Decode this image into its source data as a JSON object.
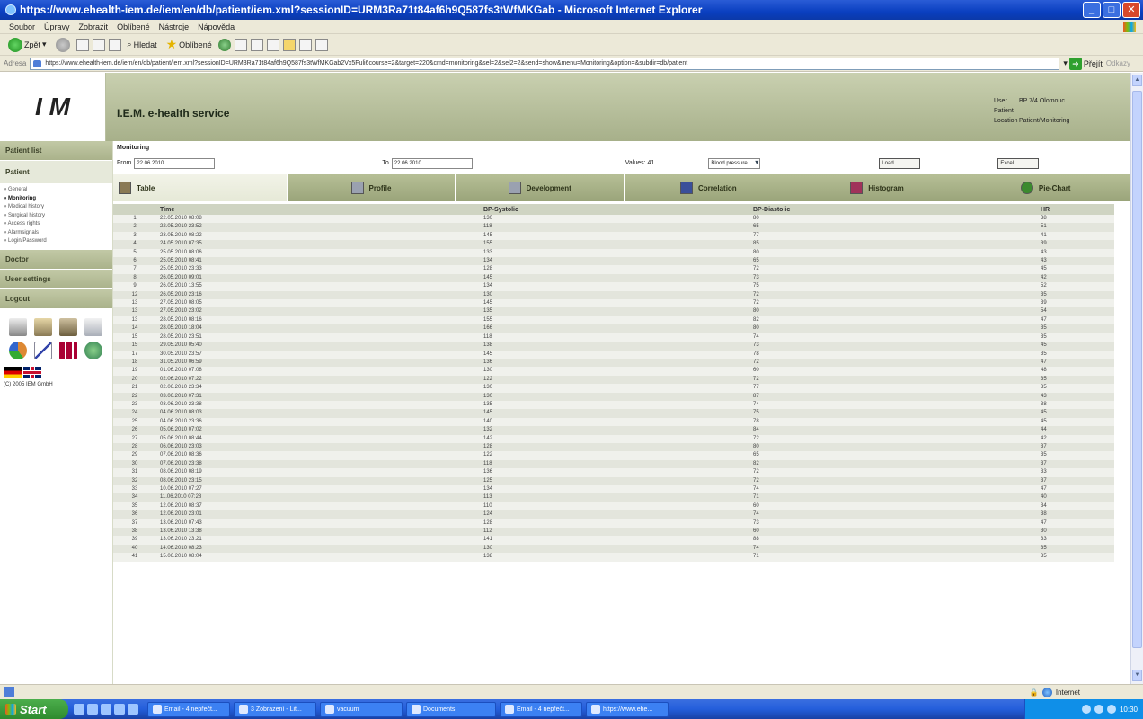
{
  "window": {
    "title": "https://www.ehealth-iem.de/iem/en/db/patient/iem.xml?sessionID=URM3Ra71t84af6h9Q587fs3tWfMKGab - Microsoft Internet Explorer",
    "minimize": "_",
    "maximize": "□",
    "close": "✕"
  },
  "menubar": [
    "Soubor",
    "Úpravy",
    "Zobrazit",
    "Oblíbené",
    "Nástroje",
    "Nápověda"
  ],
  "toolbar": {
    "back_label": "Zpět",
    "search_label": "Hledat",
    "favorites_label": "Oblíbené"
  },
  "addressbar": {
    "label": "Adresa",
    "url": "https://www.ehealth-iem.de/iem/en/db/patient/iem.xml?sessionID=URM3Ra71t84af6h9Q587fs3tWfMKGab2Vx5Fuli6course=2&target=220&cmd=monitoring&sel=2&sel2=2&send=show&menu=Monitoring&option=&subdir=db/patient",
    "go_label": "Přejít",
    "links_label": "Odkazy"
  },
  "app": {
    "logo_text": "I M",
    "service_title": "I.E.M. e-health service",
    "user": {
      "user_key": "User",
      "user_value": "BP 7/4 Olomouc",
      "patient_key": "Patient",
      "patient_value": "",
      "location_key": "Location",
      "location_value": "Patient/Monitoring"
    }
  },
  "sidebar": {
    "patient_list": "Patient list",
    "patient": "Patient",
    "sub_items": [
      {
        "label": "» General",
        "active": false
      },
      {
        "label": "» Monitoring",
        "active": true
      },
      {
        "label": "» Medical history",
        "active": false
      },
      {
        "label": "» Surgical history",
        "active": false
      },
      {
        "label": "» Access rights",
        "active": false
      },
      {
        "label": "» Alarmsignals",
        "active": false
      },
      {
        "label": "» Login/Password",
        "active": false
      }
    ],
    "doctor": "Doctor",
    "user_settings": "User settings",
    "logout": "Logout",
    "copyright": "(C) 2005 IEM GmbH"
  },
  "content": {
    "section_title": "Monitoring",
    "filters": {
      "from_label": "From",
      "from_value": "22.06.2010",
      "to_label": "To",
      "to_value": "22.06.2010",
      "values_label": "Values: 41",
      "select_value": "Blood pressure",
      "button_1": "Load",
      "button_2": "Excel"
    },
    "tabs": [
      {
        "label": "Table",
        "icon": "table-icon",
        "color": "#8a7a55",
        "active": true
      },
      {
        "label": "Profile",
        "icon": "profile-icon",
        "color": "#9aa1b0",
        "active": false
      },
      {
        "label": "Development",
        "icon": "development-icon",
        "color": "#9aa1b0",
        "active": false
      },
      {
        "label": "Correlation",
        "icon": "correlation-icon",
        "color": "#3a4f9a",
        "active": false
      },
      {
        "label": "Histogram",
        "icon": "histogram-icon",
        "color": "#a0325a",
        "active": false
      },
      {
        "label": "Pie-Chart",
        "icon": "pie-chart-icon",
        "color": "#3b8a2e",
        "active": false
      }
    ],
    "table": {
      "columns": [
        "",
        "Time",
        "BP-Systolic",
        "BP-Diastolic",
        "HR"
      ],
      "rows": [
        [
          "1",
          "22.05.2010 08:08",
          "130",
          "80",
          "38"
        ],
        [
          "2",
          "22.05.2010 23:52",
          "118",
          "65",
          "51"
        ],
        [
          "3",
          "23.05.2010 08:22",
          "145",
          "77",
          "41"
        ],
        [
          "4",
          "24.05.2010 07:35",
          "155",
          "85",
          "39"
        ],
        [
          "5",
          "25.05.2010 08:06",
          "133",
          "80",
          "43"
        ],
        [
          "6",
          "25.05.2010 08:41",
          "134",
          "65",
          "43"
        ],
        [
          "7",
          "25.05.2010 23:33",
          "128",
          "72",
          "45"
        ],
        [
          "8",
          "26.05.2010 09:01",
          "145",
          "73",
          "42"
        ],
        [
          "9",
          "26.05.2010 13:55",
          "134",
          "75",
          "52"
        ],
        [
          "12",
          "26.05.2010 23:16",
          "130",
          "72",
          "35"
        ],
        [
          "13",
          "27.05.2010 08:05",
          "145",
          "72",
          "39"
        ],
        [
          "13",
          "27.05.2010 23:02",
          "135",
          "80",
          "54"
        ],
        [
          "13",
          "28.05.2010 08:16",
          "155",
          "82",
          "47"
        ],
        [
          "14",
          "28.05.2010 18:04",
          "166",
          "80",
          "35"
        ],
        [
          "15",
          "28.05.2010 23:51",
          "118",
          "74",
          "35"
        ],
        [
          "15",
          "29.05.2010 05:40",
          "138",
          "73",
          "45"
        ],
        [
          "17",
          "30.05.2010 23:57",
          "145",
          "78",
          "35"
        ],
        [
          "18",
          "31.05.2010 06:59",
          "136",
          "72",
          "47"
        ],
        [
          "19",
          "01.06.2010 07:08",
          "130",
          "60",
          "48"
        ],
        [
          "20",
          "02.06.2010 07:22",
          "122",
          "72",
          "35"
        ],
        [
          "21",
          "02.06.2010 23:34",
          "130",
          "77",
          "35"
        ],
        [
          "22",
          "03.06.2010 07:31",
          "130",
          "87",
          "43"
        ],
        [
          "23",
          "03.06.2010 23:38",
          "135",
          "74",
          "38"
        ],
        [
          "24",
          "04.06.2010 08:03",
          "145",
          "75",
          "45"
        ],
        [
          "25",
          "04.06.2010 23:36",
          "140",
          "78",
          "45"
        ],
        [
          "26",
          "05.06.2010 07:02",
          "132",
          "84",
          "44"
        ],
        [
          "27",
          "05.06.2010 08:44",
          "142",
          "72",
          "42"
        ],
        [
          "28",
          "06.06.2010 23:03",
          "128",
          "80",
          "37"
        ],
        [
          "29",
          "07.06.2010 08:36",
          "122",
          "65",
          "35"
        ],
        [
          "30",
          "07.06.2010 23:38",
          "118",
          "82",
          "37"
        ],
        [
          "31",
          "08.06.2010 08:19",
          "136",
          "72",
          "33"
        ],
        [
          "32",
          "08.06.2010 23:15",
          "125",
          "72",
          "37"
        ],
        [
          "33",
          "10.06.2010 07:27",
          "134",
          "74",
          "47"
        ],
        [
          "34",
          "11.06.2010 07:28",
          "113",
          "71",
          "40"
        ],
        [
          "35",
          "12.06.2010 08:37",
          "110",
          "60",
          "34"
        ],
        [
          "36",
          "12.06.2010 23:01",
          "124",
          "74",
          "38"
        ],
        [
          "37",
          "13.06.2010 07:43",
          "128",
          "73",
          "47"
        ],
        [
          "38",
          "13.06.2010 13:38",
          "112",
          "60",
          "30"
        ],
        [
          "39",
          "13.06.2010 23:21",
          "141",
          "88",
          "33"
        ],
        [
          "40",
          "14.06.2010 08:23",
          "130",
          "74",
          "35"
        ],
        [
          "41",
          "15.06.2010 08:04",
          "138",
          "71",
          "35"
        ]
      ]
    }
  },
  "statusbar": {
    "zone": "Internet"
  },
  "taskbar": {
    "start": "Start",
    "items": [
      "Email - 4 nepřečt...",
      "3 Zobrazení - Lit...",
      "vacuum",
      "Documents",
      "Email - 4 nepřečt...",
      "https://www.ehe..."
    ],
    "clock": "10:30"
  }
}
